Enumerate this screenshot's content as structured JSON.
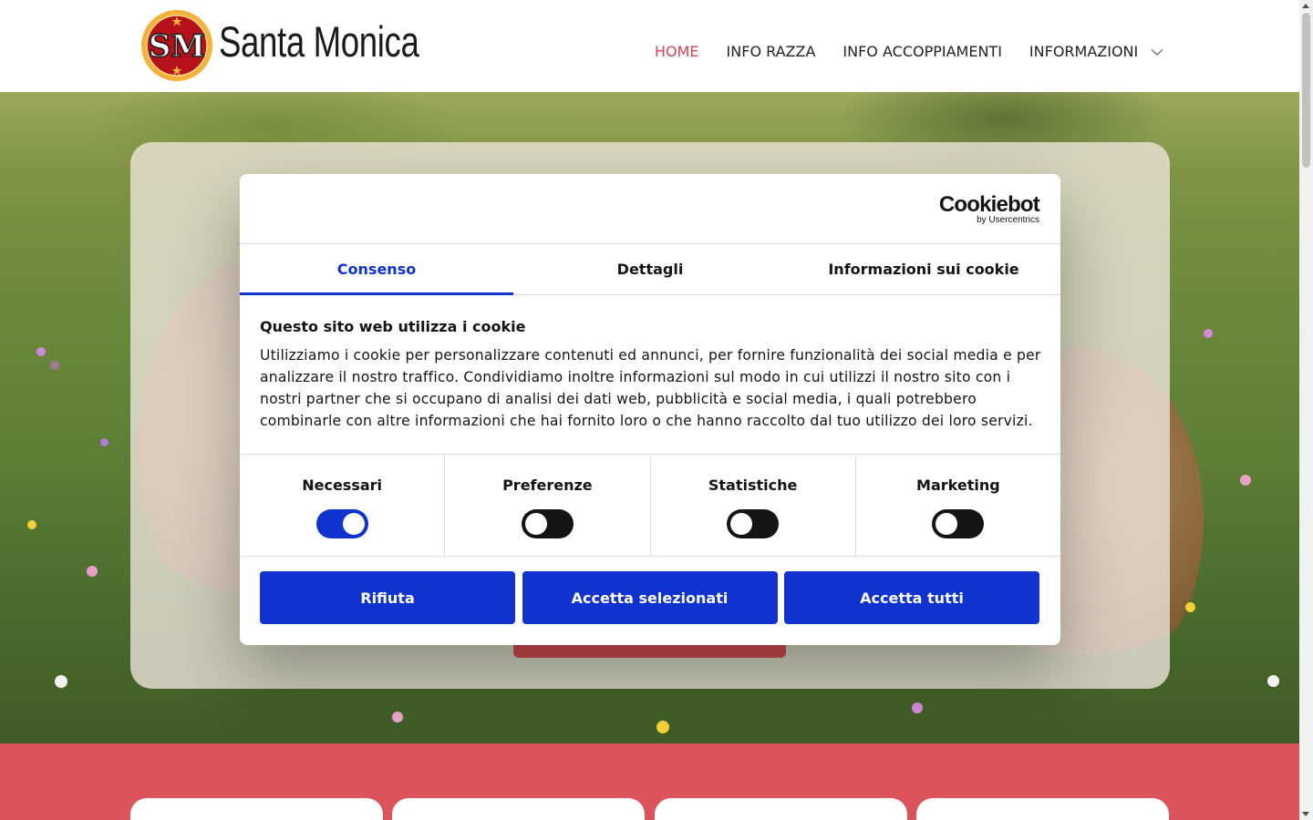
{
  "brand": {
    "name": "Santa Monica",
    "logo_text": "SM"
  },
  "nav": {
    "items": [
      {
        "label": "HOME",
        "active": true
      },
      {
        "label": "INFO RAZZA",
        "active": false
      },
      {
        "label": "INFO ACCOPPIAMENTI",
        "active": false
      }
    ],
    "dropdown_label": "INFORMAZIONI",
    "dropdown_icon": "chevron-down-icon"
  },
  "cookie_dialog": {
    "provider": "Cookiebot",
    "provider_sub": "by Usercentrics",
    "tabs": [
      {
        "label": "Consenso",
        "active": true
      },
      {
        "label": "Dettagli",
        "active": false
      },
      {
        "label": "Informazioni sui cookie",
        "active": false
      }
    ],
    "title": "Questo sito web utilizza i cookie",
    "body": "Utilizziamo i cookie per personalizzare contenuti ed annunci, per fornire funzionalità dei social media e per analizzare il nostro traffico. Condividiamo inoltre informazioni sul modo in cui utilizzi il nostro sito con i nostri partner che si occupano di analisi dei dati web, pubblicità e social media, i quali potrebbero combinarle con altre informazioni che hai fornito loro o che hanno raccolto dal tuo utilizzo dei loro servizi.",
    "preferences": [
      {
        "label": "Necessari",
        "checked": true
      },
      {
        "label": "Preferenze",
        "checked": false
      },
      {
        "label": "Statistiche",
        "checked": false
      },
      {
        "label": "Marketing",
        "checked": false
      }
    ],
    "buttons": {
      "reject": "Rifiuta",
      "accept_selected": "Accetta selezionati",
      "accept_all": "Accetta tutti"
    }
  },
  "colors": {
    "accent_red": "#db535b",
    "nav_active": "#d9414f",
    "cookie_blue": "#1032cf"
  }
}
